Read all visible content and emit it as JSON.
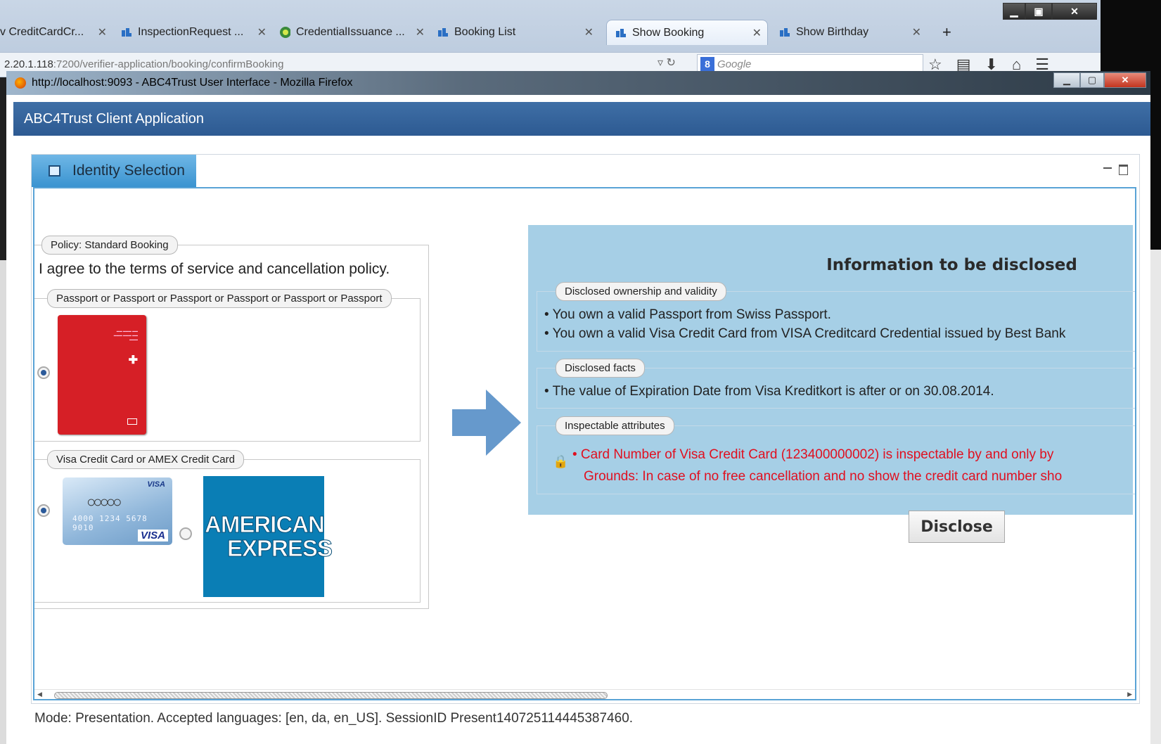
{
  "background_browser": {
    "tabs": [
      {
        "label": "v CreditCardCr..."
      },
      {
        "label": "InspectionRequest ..."
      },
      {
        "label": "CredentialIssuance ..."
      },
      {
        "label": "Booking List"
      },
      {
        "label": "Show Booking"
      },
      {
        "label": "Show Birthday"
      }
    ],
    "new_tab_label": "+",
    "url_host": "2.20.1.118",
    "url_path": ":7200/verifier-application/booking/confirmBooking",
    "search_placeholder": "Google",
    "search_logo": "8"
  },
  "window": {
    "title": "http://localhost:9093 - ABC4Trust User Interface - Mozilla Firefox"
  },
  "app": {
    "title": "ABC4Trust Client Application",
    "panel_tab": "Identity Selection"
  },
  "policy": {
    "legend": "Policy: Standard Booking",
    "agree_text": "I agree to the terms of service and cancellation policy.",
    "group1_legend": "Passport or Passport or Passport or Passport or Passport or Passport",
    "group2_legend": "Visa Credit Card or AMEX Credit Card",
    "visa_number": "4000 1234 5678 9010",
    "visa_brand": "VISA",
    "amex_line1": "AMERICAN",
    "amex_line2": "EXPRESS"
  },
  "info": {
    "heading": "Information to be disclosed",
    "ownership_legend": "Disclosed ownership and validity",
    "ownership_items": [
      "• You own a valid Passport from Swiss Passport.",
      "• You own a valid Visa Credit Card from VISA Creditcard Credential issued by Best Bank"
    ],
    "facts_legend": "Disclosed facts",
    "facts_items": [
      "• The value of Expiration Date from Visa Kreditkort is after or on 30.08.2014."
    ],
    "inspect_legend": "Inspectable attributes",
    "inspect_line1": "• Card Number of Visa Credit Card (123400000002) is inspectable by and only by",
    "inspect_line2": "Grounds: In case of no free cancellation and no show the credit card number sho"
  },
  "disclose_label": "Disclose",
  "status_text": "Mode: Presentation. Accepted languages: [en, da, en_US]. SessionID Present140725114445387460."
}
